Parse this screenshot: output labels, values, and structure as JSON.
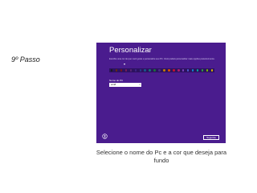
{
  "slide": {
    "step_label": "9º Passo",
    "caption": "Selecione o nome do Pc e a cor que deseja para fundo"
  },
  "screen": {
    "title": "Personalizar",
    "description": "Escolha uma cor de que você goste e personalize seu PC. Você poderá personalizar mais opções posteriormente.",
    "background_color": "#4a1c8e",
    "swatch_colors": [
      "#1a1a1a",
      "#6b2b0e",
      "#7b1618",
      "#7a1c5a",
      "#5a2474",
      "#3c2587",
      "#253a8c",
      "#17578e",
      "#15707b",
      "#1a6f3b",
      "#4b2a87",
      "#c47a00",
      "#d84d00",
      "#c8102e",
      "#b01d6c",
      "#7d3fbf",
      "#4a5fd1",
      "#0f84d4",
      "#00a6a0",
      "#2ea043",
      "#7fba00",
      "#d9b200"
    ],
    "field_label": "Nome do PC",
    "pc_name": "win8",
    "clear_glyph": "×",
    "next_label": "Seguinte"
  },
  "icons": {
    "ease_of_access": "ease-of-access-icon"
  }
}
